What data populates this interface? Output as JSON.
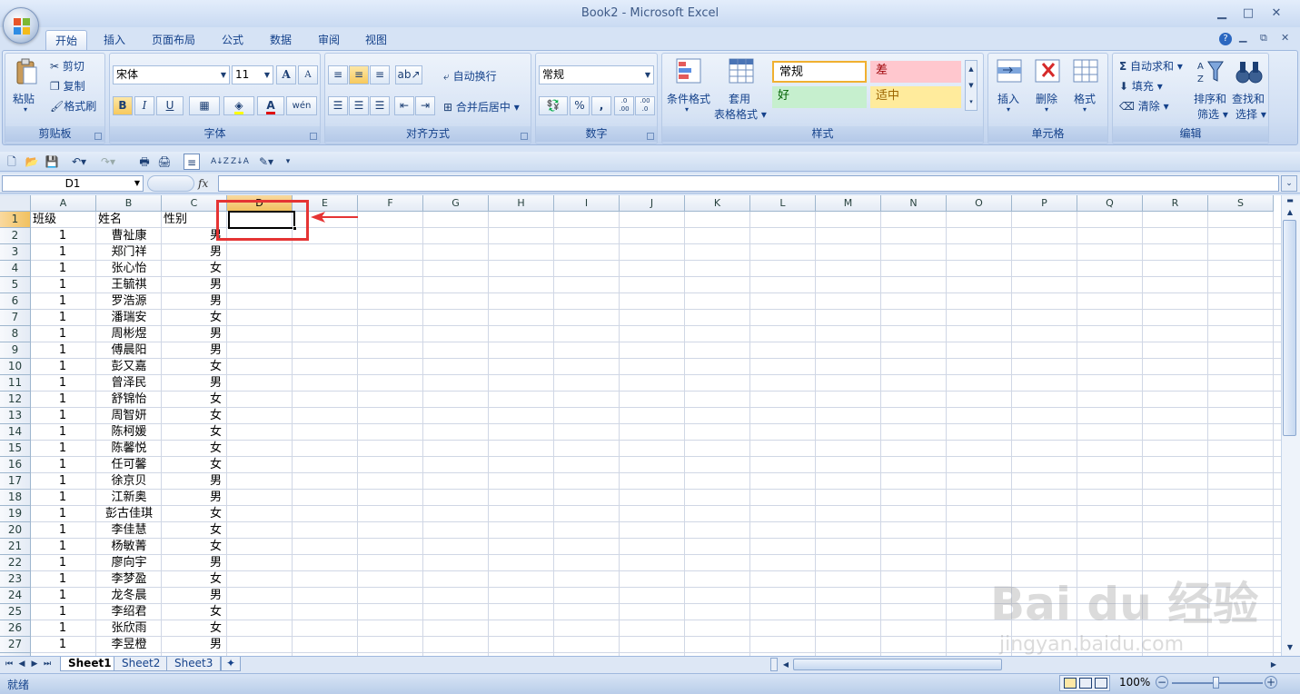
{
  "window": {
    "title": "Book2 - Microsoft Excel",
    "min": "▁",
    "max": "□",
    "close": "✕"
  },
  "tabs": [
    "开始",
    "插入",
    "页面布局",
    "公式",
    "数据",
    "审阅",
    "视图"
  ],
  "ribbon": {
    "clipboard": {
      "label": "剪贴板",
      "paste": "粘贴",
      "cut": "剪切",
      "copy": "复制",
      "format_painter": "格式刷"
    },
    "font": {
      "label": "字体",
      "name": "宋体",
      "size": "11",
      "bold": "B",
      "italic": "I",
      "underline": "U",
      "grow": "A",
      "shrink": "A",
      "wen": "wén"
    },
    "alignment": {
      "label": "对齐方式",
      "wrap": "自动换行",
      "merge": "合并后居中"
    },
    "number": {
      "label": "数字",
      "format": "常规",
      "percent": "%",
      "comma": ",",
      "inc": ".0 .00",
      "dec": ".00 .0"
    },
    "styles": {
      "label": "样式",
      "conditional": "条件格式",
      "table": "套用",
      "table2": "表格格式",
      "normal": "常规",
      "bad": "差",
      "good": "好",
      "neutral": "适中"
    },
    "cells": {
      "label": "单元格",
      "insert": "插入",
      "delete": "删除",
      "format": "格式"
    },
    "editing": {
      "label": "编辑",
      "autosum": "自动求和",
      "fill": "填充",
      "clear": "清除",
      "sort": "排序和",
      "sort2": "筛选",
      "find": "查找和",
      "find2": "选择"
    }
  },
  "formula_bar": {
    "name_box": "D1",
    "fx": "fx",
    "value": ""
  },
  "columns": [
    "A",
    "B",
    "C",
    "D",
    "E",
    "F",
    "G",
    "H",
    "I",
    "J",
    "K",
    "L",
    "M",
    "N",
    "O",
    "P",
    "Q",
    "R",
    "S"
  ],
  "header_row": {
    "a": "班级",
    "b": "姓名",
    "c": "性别"
  },
  "rows": [
    {
      "n": "2",
      "a": "1",
      "b": "曹祉康",
      "c": "男"
    },
    {
      "n": "3",
      "a": "1",
      "b": "郑门祥",
      "c": "男"
    },
    {
      "n": "4",
      "a": "1",
      "b": "张心怡",
      "c": "女"
    },
    {
      "n": "5",
      "a": "1",
      "b": "王毓祺",
      "c": "男"
    },
    {
      "n": "6",
      "a": "1",
      "b": "罗浩源",
      "c": "男"
    },
    {
      "n": "7",
      "a": "1",
      "b": "潘瑞安",
      "c": "女"
    },
    {
      "n": "8",
      "a": "1",
      "b": "周彬煜",
      "c": "男"
    },
    {
      "n": "9",
      "a": "1",
      "b": "傅晨阳",
      "c": "男"
    },
    {
      "n": "10",
      "a": "1",
      "b": "彭又嘉",
      "c": "女"
    },
    {
      "n": "11",
      "a": "1",
      "b": "曾泽民",
      "c": "男"
    },
    {
      "n": "12",
      "a": "1",
      "b": "舒锦怡",
      "c": "女"
    },
    {
      "n": "13",
      "a": "1",
      "b": "周智妍",
      "c": "女"
    },
    {
      "n": "14",
      "a": "1",
      "b": "陈柯媛",
      "c": "女"
    },
    {
      "n": "15",
      "a": "1",
      "b": "陈馨悦",
      "c": "女"
    },
    {
      "n": "16",
      "a": "1",
      "b": "任可馨",
      "c": "女"
    },
    {
      "n": "17",
      "a": "1",
      "b": "徐京贝",
      "c": "男"
    },
    {
      "n": "18",
      "a": "1",
      "b": "江新奥",
      "c": "男"
    },
    {
      "n": "19",
      "a": "1",
      "b": "彭古佳琪",
      "c": "女"
    },
    {
      "n": "20",
      "a": "1",
      "b": "李佳慧",
      "c": "女"
    },
    {
      "n": "21",
      "a": "1",
      "b": "杨敏菁",
      "c": "女"
    },
    {
      "n": "22",
      "a": "1",
      "b": "廖向宇",
      "c": "男"
    },
    {
      "n": "23",
      "a": "1",
      "b": "李梦盈",
      "c": "女"
    },
    {
      "n": "24",
      "a": "1",
      "b": "龙冬晨",
      "c": "男"
    },
    {
      "n": "25",
      "a": "1",
      "b": "李绍君",
      "c": "女"
    },
    {
      "n": "26",
      "a": "1",
      "b": "张欣雨",
      "c": "女"
    },
    {
      "n": "27",
      "a": "1",
      "b": "李昱橙",
      "c": "男"
    }
  ],
  "sheets": [
    "Sheet1",
    "Sheet2",
    "Sheet3"
  ],
  "status": {
    "ready": "就绪",
    "zoom": "100%"
  },
  "watermark": {
    "brand": "Bai du 经验",
    "url": "jingyan.baidu.com"
  },
  "colors": {
    "accent": "#e53434",
    "selected_header": "#f1c15f"
  }
}
